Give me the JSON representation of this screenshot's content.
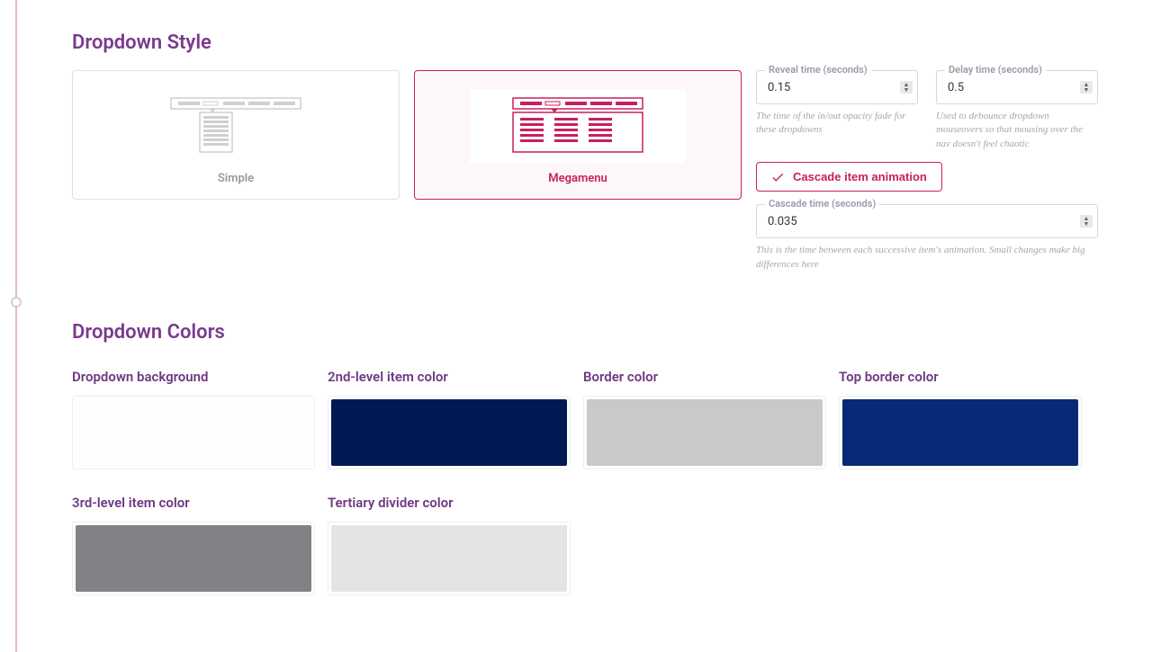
{
  "section_style_title": "Dropdown Style",
  "section_colors_title": "Dropdown Colors",
  "style_cards": {
    "simple_label": "Simple",
    "megamenu_label": "Megamenu"
  },
  "settings": {
    "reveal_label": "Reveal time (seconds)",
    "reveal_value": "0.15",
    "reveal_help": "The time of the in/out opacity fade for these dropdowns",
    "delay_label": "Delay time (seconds)",
    "delay_value": "0.5",
    "delay_help": "Used to debounce dropdown mouseovers so that mousing over the nav doesn't feel chaotic",
    "cascade_toggle_label": "Cascade item animation",
    "cascade_label": "Cascade time (seconds)",
    "cascade_value": "0.035",
    "cascade_help": "This is the time between each successive item's animation. Small changes make big differences here"
  },
  "colors": {
    "bg_label": "Dropdown background",
    "l2_label": "2nd-level item color",
    "border_label": "Border color",
    "top_label": "Top border color",
    "l3_label": "3rd-level item color",
    "div_label": "Tertiary divider color"
  }
}
